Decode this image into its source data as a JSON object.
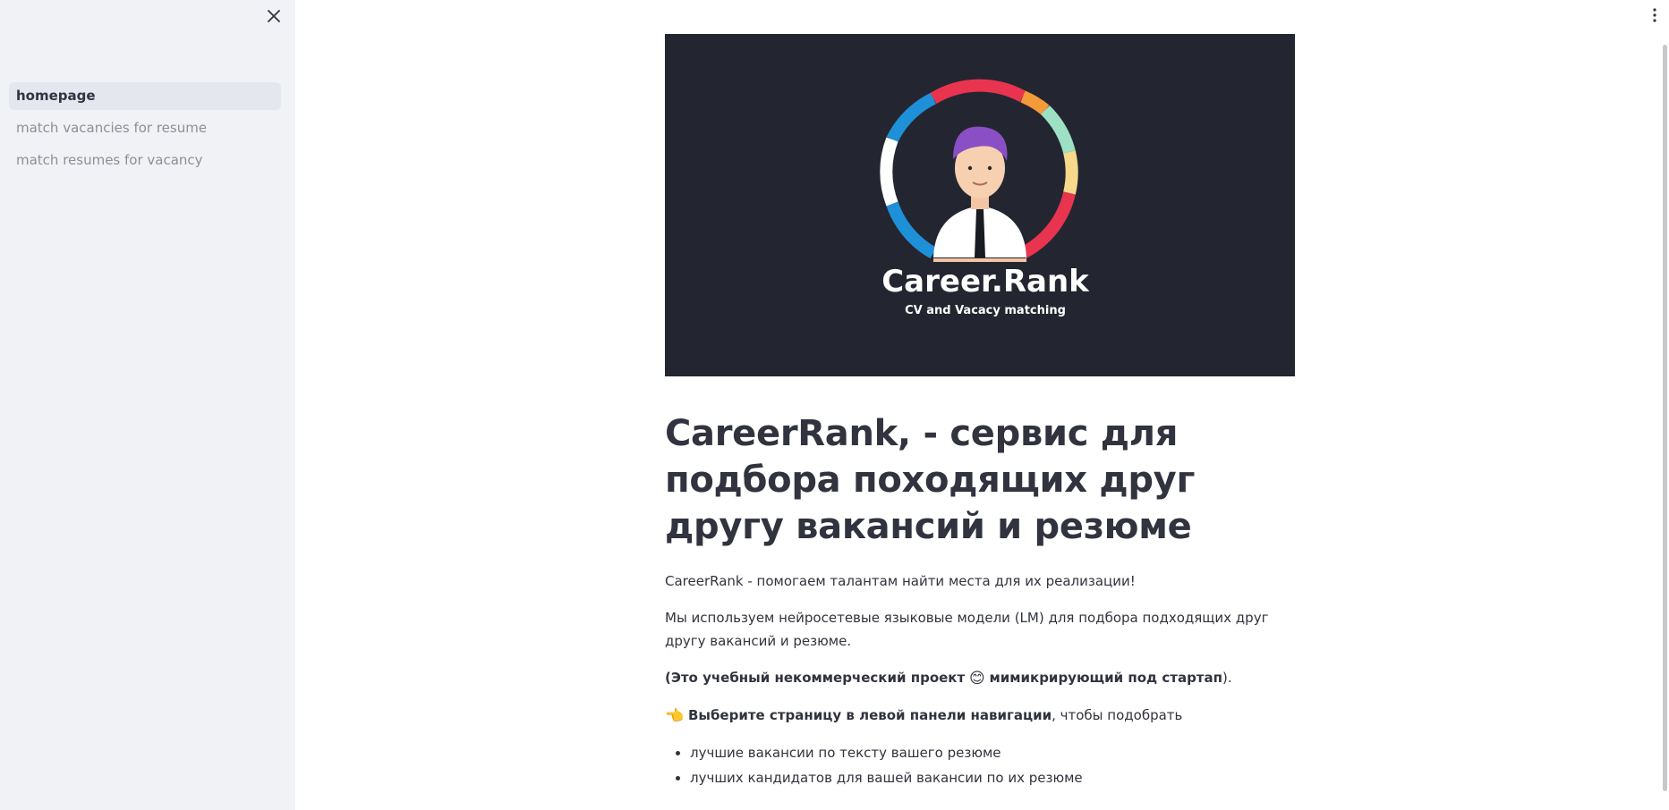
{
  "sidebar": {
    "nav": [
      {
        "label": "homepage",
        "active": true
      },
      {
        "label": "match vacancies for resume",
        "active": false
      },
      {
        "label": "match resumes for vacancy",
        "active": false
      }
    ]
  },
  "banner": {
    "brand_name": "Career.Rank",
    "tagline": "CV and Vacacy matching"
  },
  "main": {
    "title": "CareerRank, - сервис для подбора походящих друг другу вакансий и резюме",
    "intro": "CareerRank - помогаем талантам найти места для их реализации!",
    "description": "Мы используем нейросетевые языковые модели (LM) для подбора подходящих друг другу вакансий и резюме.",
    "note_open": "(",
    "note_bold_1": "Это учебный некоммерческий проект",
    "note_emoji": "😊",
    "note_bold_2": "мимикрирующий под стартап",
    "note_close": ").",
    "cta_emoji": "👈",
    "cta_bold": "Выберите страницу в левой панели навигации",
    "cta_rest": ", чтобы подобрать",
    "bullets": [
      "лучшие вакансии по тексту вашего резюме",
      "лучших кандидатов для вашей вакансии по их резюме"
    ]
  },
  "colors": {
    "sidebar_bg": "#f0f2f6",
    "banner_bg": "#232630",
    "text": "#31333f",
    "nav_inactive": "#8e8f96"
  }
}
